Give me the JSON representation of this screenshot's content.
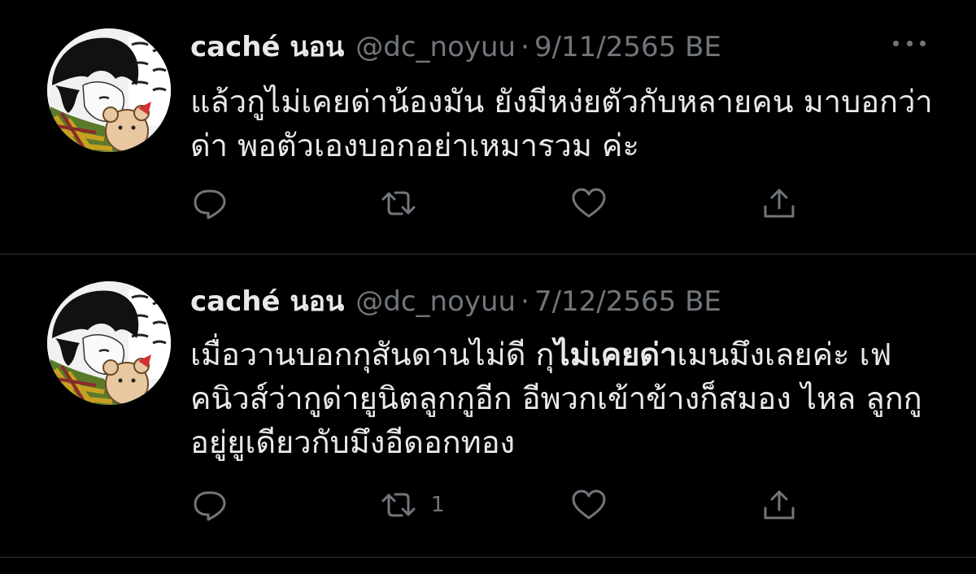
{
  "tweets": [
    {
      "display_name": "caché นอน",
      "handle": "@dc_noyuu",
      "separator": "·",
      "date": "9/11/2565 BE",
      "text_parts": [
        {
          "text": "แล้วกูไม่เคยด่าน้องมัน ยังมีหง่ยตัวกับหลายคน มาบอกว่าด่า พอตัวเองบอกอย่าเหมารวม ค่ะ",
          "bold": false
        }
      ],
      "reply_count": "",
      "retweet_count": "",
      "like_count": "",
      "icons": [
        "reply-icon",
        "retweet-icon",
        "like-icon",
        "share-icon",
        "more-icon"
      ]
    },
    {
      "display_name": "caché นอน",
      "handle": "@dc_noyuu",
      "separator": "·",
      "date": "7/12/2565 BE",
      "text_parts": [
        {
          "text": "เมื่อวานบอกกุสันดานไม่ดี กุ",
          "bold": false
        },
        {
          "text": "ไม่เคยด่า",
          "bold": true
        },
        {
          "text": "เมนมึงเลยค่ะ เฟคนิวส์ว่ากูด่ายูนิตลูกกูอีก อีพวกเข้าข้างก็สมอง ไหล ลูกกูอยู่ยูเดียวกับมึงอีดอกทอง",
          "bold": false
        }
      ],
      "reply_count": "",
      "retweet_count": "1",
      "like_count": "",
      "icons": [
        "reply-icon",
        "retweet-icon",
        "like-icon",
        "share-icon",
        "more-icon"
      ]
    }
  ],
  "colors": {
    "background": "#000000",
    "text_primary": "#e7e9ea",
    "text_secondary": "#71767b",
    "divider": "#2f3336"
  }
}
